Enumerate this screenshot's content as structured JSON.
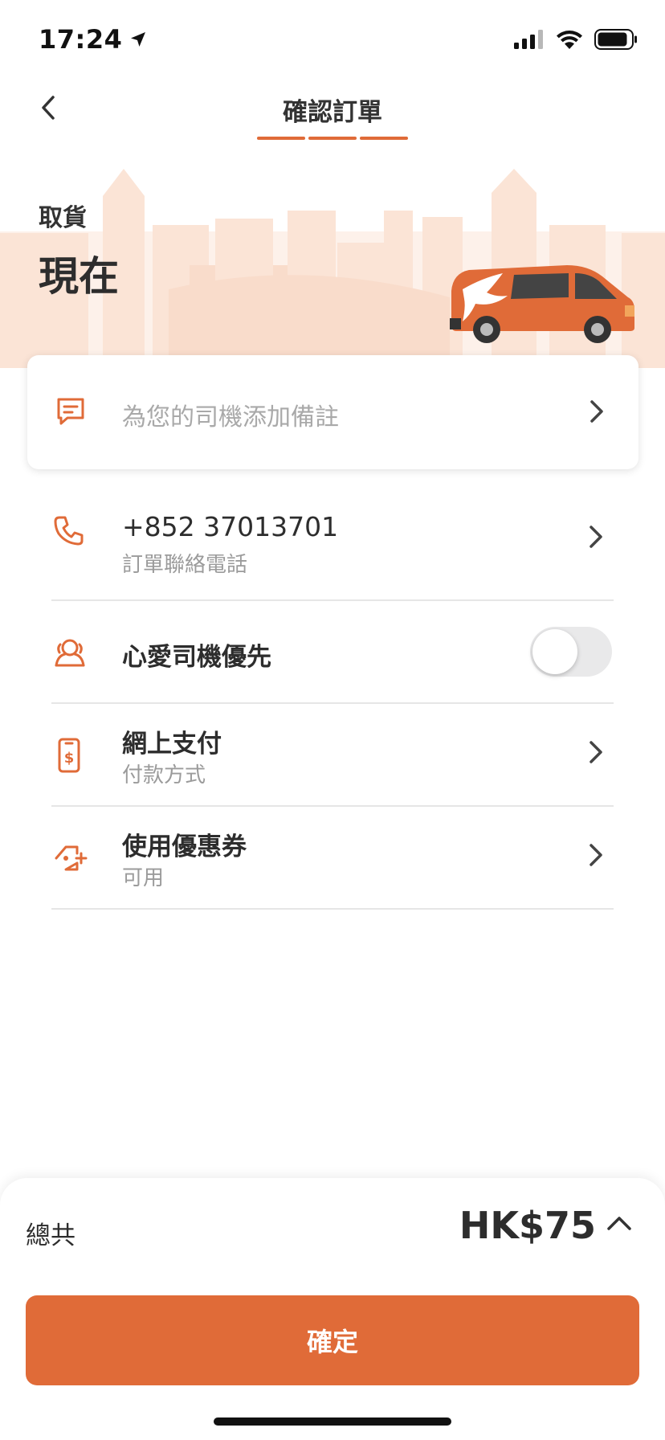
{
  "status_bar": {
    "time": "17:24"
  },
  "header": {
    "title": "確認訂單"
  },
  "pickup": {
    "label": "取貨",
    "time": "現在"
  },
  "notes": {
    "placeholder": "為您的司機添加備註"
  },
  "contact": {
    "phone": "+852 37013701",
    "label": "訂單聯絡電話"
  },
  "favorite_driver": {
    "label": "心愛司機優先",
    "enabled": false
  },
  "payment": {
    "title": "網上支付",
    "subtitle": "付款方式"
  },
  "coupon": {
    "title": "使用優惠券",
    "subtitle": "可用"
  },
  "footer": {
    "total_label": "總共",
    "total_amount": "HK$75",
    "confirm_label": "確定"
  },
  "colors": {
    "accent": "#e06b38",
    "hero_bg": "#fdf1ea"
  }
}
